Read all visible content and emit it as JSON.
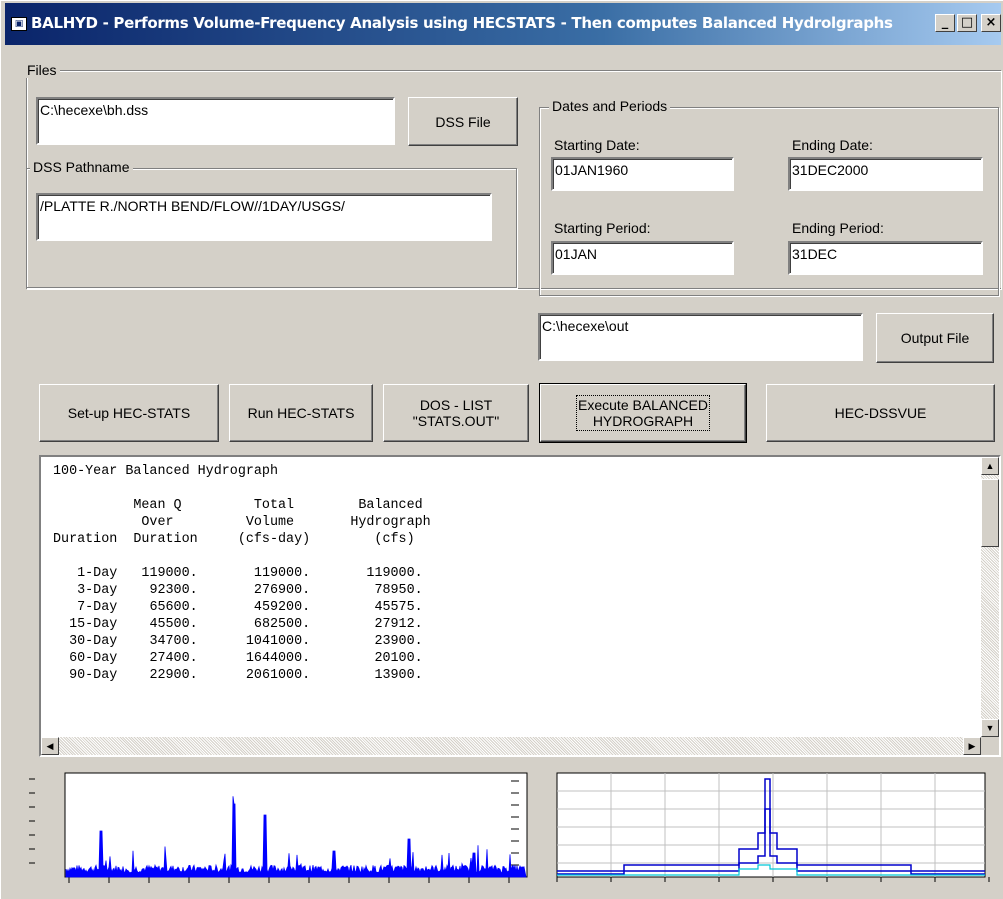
{
  "window": {
    "title": "BALHYD - Performs Volume-Frequency Analysis using HECSTATS - Then computes Balanced Hydrolgraphs",
    "icon": "app-icon",
    "controls": {
      "minimize": "_",
      "maximize": "□",
      "close": "×"
    }
  },
  "files": {
    "group_label": "Files",
    "dss_file_value": "C:\\hecexe\\bh.dss",
    "dss_file_button": "DSS File"
  },
  "pathname": {
    "group_label": "DSS Pathname",
    "value": "/PLATTE R./NORTH BEND/FLOW//1DAY/USGS/"
  },
  "dates": {
    "group_label": "Dates and Periods",
    "starting_date_label": "Starting Date:",
    "starting_date": "01JAN1960",
    "ending_date_label": "Ending Date:",
    "ending_date": "31DEC2000",
    "starting_period_label": "Starting Period:",
    "starting_period": "01JAN",
    "ending_period_label": "Ending Period:",
    "ending_period": "31DEC"
  },
  "output": {
    "value": "C:\\hecexe\\out",
    "button": "Output File"
  },
  "actions": {
    "setup": "Set-up  HEC-STATS",
    "run": "Run HEC-STATS",
    "doslist": "DOS - LIST\n\"STATS.OUT\"",
    "execute": "Execute BALANCED\nHYDROGRAPH",
    "dssvue": "HEC-DSSVUE"
  },
  "report": {
    "title": "100-Year Balanced Hydrograph",
    "header_lines": [
      "          Mean Q         Total        Balanced",
      "           Over         Volume       Hydrograph",
      "Duration  Duration     (cfs-day)        (cfs)"
    ],
    "rows": [
      {
        "duration": "1-Day",
        "mean_q": "119000.",
        "total_volume": "119000.",
        "balanced": "119000."
      },
      {
        "duration": "3-Day",
        "mean_q": "92300.",
        "total_volume": "276900.",
        "balanced": "78950."
      },
      {
        "duration": "7-Day",
        "mean_q": "65600.",
        "total_volume": "459200.",
        "balanced": "45575."
      },
      {
        "duration": "15-Day",
        "mean_q": "45500.",
        "total_volume": "682500.",
        "balanced": "27912."
      },
      {
        "duration": "30-Day",
        "mean_q": "34700.",
        "total_volume": "1041000.",
        "balanced": "23900."
      },
      {
        "duration": "60-Day",
        "mean_q": "27400.",
        "total_volume": "1644000.",
        "balanced": "20100."
      },
      {
        "duration": "90-Day",
        "mean_q": "22900.",
        "total_volume": "2061000.",
        "balanced": "13900."
      }
    ]
  },
  "charts": {
    "left_series_color": "#0000ff",
    "right_series_colors": [
      "#0000cc",
      "#0000cc",
      "#0000cc",
      "#00c8d8"
    ]
  }
}
